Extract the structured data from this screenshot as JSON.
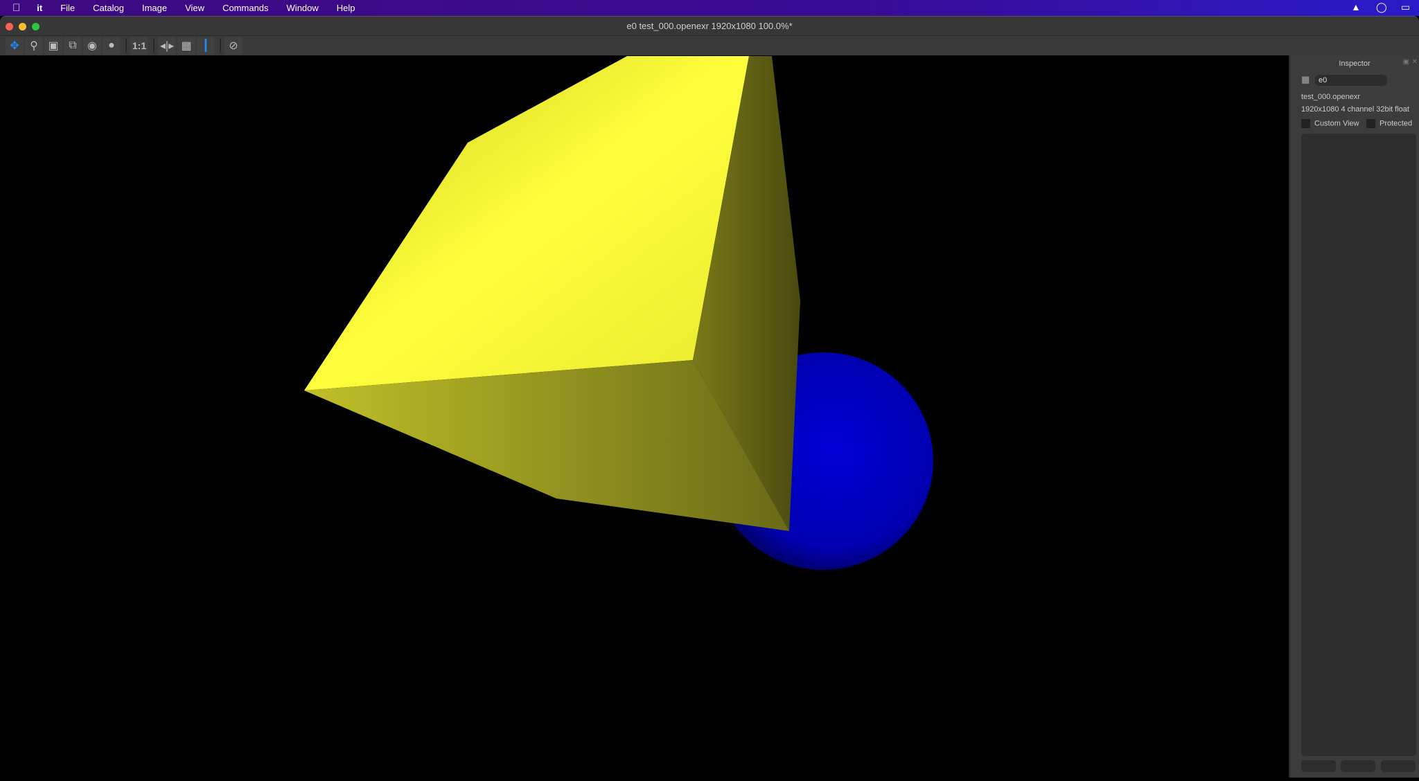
{
  "menubar": {
    "app": "it",
    "items": [
      "File",
      "Catalog",
      "Image",
      "View",
      "Commands",
      "Window",
      "Help"
    ]
  },
  "window": {
    "title": "e0 test_000.openexr 1920x1080 100.0%*"
  },
  "toolbar": {
    "tools": [
      "pan-tool",
      "zoom-tool",
      "movie-tool",
      "layers-tool",
      "globe-pointer-tool",
      "sphere-pointer-tool",
      "1:1",
      "split-tool",
      "image-tool",
      "crosshair-tool",
      "movie-disabled-tool"
    ],
    "one_to_one": "1:1",
    "accent": "#1a8cff"
  },
  "scene": {
    "cube_color": "#ffff3c",
    "sphere_color": "#0000c8",
    "background": "#000000"
  },
  "inspector": {
    "title": "Inspector",
    "name": "e0",
    "filename": "test_000.openexr",
    "info": "1920x1080 4 channel 32bit float",
    "custom_view": "Custom View",
    "protected": "Protected"
  }
}
